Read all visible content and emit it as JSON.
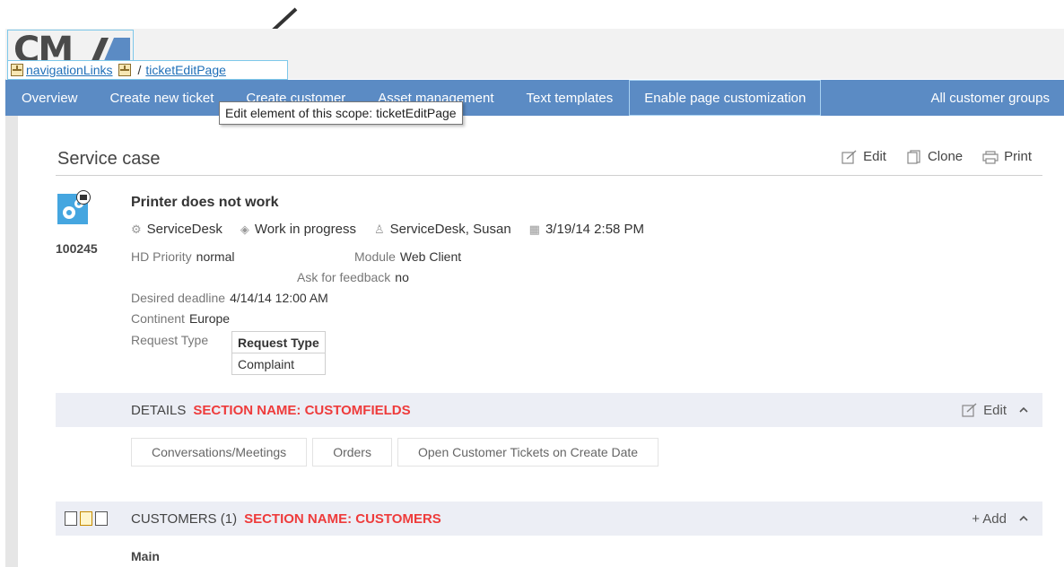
{
  "logo": {
    "text": "CM"
  },
  "scope_bar": {
    "link1": "navigationLinks",
    "separator": "/",
    "link2": "ticketEditPage"
  },
  "nav": {
    "items": [
      "Overview",
      "Create new ticket",
      "Create customer",
      "Asset management",
      "Text templates",
      "Enable page customization"
    ],
    "right": "All customer groups"
  },
  "tooltip": "Edit element of this scope: ticketEditPage",
  "service_case": {
    "title": "Service case",
    "actions": {
      "edit": "Edit",
      "clone": "Clone",
      "print": "Print"
    }
  },
  "ticket": {
    "number": "100245",
    "title": "Printer does not work",
    "meta": {
      "queue": "ServiceDesk",
      "status": "Work in progress",
      "assignee": "ServiceDesk, Susan",
      "date": "3/19/14 2:58 PM"
    },
    "fields": {
      "hd_priority_label": "HD Priority",
      "hd_priority_value": "normal",
      "module_label": "Module",
      "module_value": "Web Client",
      "ask_feedback_label": "Ask for feedback",
      "ask_feedback_value": "no",
      "desired_deadline_label": "Desired deadline",
      "desired_deadline_value": "4/14/14 12:00 AM",
      "continent_label": "Continent",
      "continent_value": "Europe",
      "request_type_label": "Request Type"
    },
    "request_table": {
      "header": "Request Type",
      "value": "Complaint"
    }
  },
  "details_section": {
    "label": "DETAILS",
    "name": "SECTION NAME: CUSTOMFIELDS",
    "action": "Edit",
    "tabs": [
      "Conversations/Meetings",
      "Orders",
      "Open Customer Tickets on Create Date"
    ]
  },
  "customers_section": {
    "label": "CUSTOMERS (1)",
    "name": "SECTION NAME: CUSTOMERS",
    "action": "+ Add",
    "sub_label": "Main"
  },
  "colors": {
    "nav_bg": "#5b8bc4",
    "section_bg": "#eceef5",
    "section_name": "#ee3b3b",
    "link": "#1f6fb8",
    "ticket_icon": "#45a6e0"
  }
}
